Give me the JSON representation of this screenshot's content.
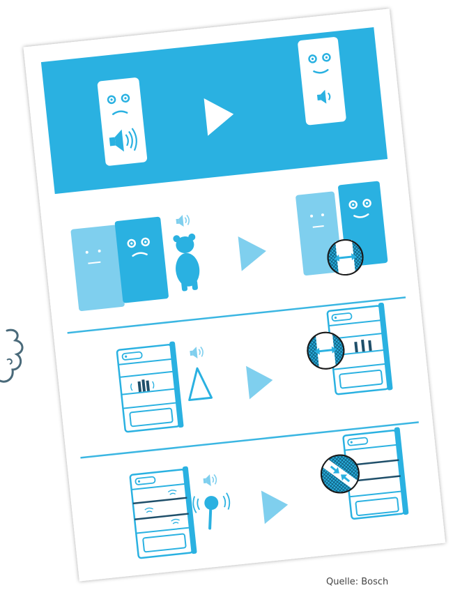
{
  "page": {
    "background": "#ffffff"
  },
  "sheet": {
    "background": "#ffffff",
    "accent": "#2ab1e1",
    "accent_light": "#7fcfee",
    "line": "#3bb6e2"
  },
  "panels": [
    {
      "id": "adjust-noise",
      "before": "unhappy-fridge-loud-speaker",
      "after": "happy-fridge-quiet-speaker"
    },
    {
      "id": "gap-between-units",
      "before": "two-units-touching-bear-hum",
      "after": "units-with-gap-detail"
    },
    {
      "id": "bottles-touching",
      "before": "bottles-touching-shelf",
      "after": "bottles-separated-detail"
    },
    {
      "id": "pipes-touching",
      "before": "pipes-vibrating",
      "after": "pipes-separated-detail"
    }
  ],
  "caption": {
    "text": "Quelle: Bosch"
  }
}
